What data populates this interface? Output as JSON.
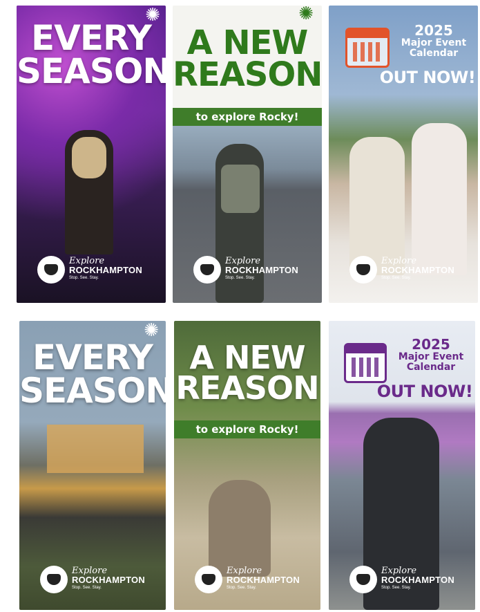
{
  "panels": [
    {
      "headline": [
        "EVERY",
        "SEASON"
      ]
    },
    {
      "headline": [
        "A NEW",
        "REASON"
      ],
      "band": "to explore Rocky!"
    },
    {
      "year": "2025",
      "line1": "Major Event",
      "line2": "Calendar",
      "out": "OUT NOW!"
    },
    {
      "headline": [
        "EVERY",
        "SEASON"
      ]
    },
    {
      "headline": [
        "A NEW",
        "REASON"
      ],
      "band": "to explore Rocky!"
    },
    {
      "year": "2025",
      "line1": "Major Event",
      "line2": "Calendar",
      "out": "OUT NOW!"
    }
  ],
  "logo": {
    "script": "Explore",
    "name": "ROCKHAMPTON",
    "tagline": "Stop. See. Stay."
  },
  "colors": {
    "green": "#3f7d2a",
    "dark_green": "#2f7a1c",
    "orange": "#e2532a",
    "purple": "#6a2a8a"
  }
}
